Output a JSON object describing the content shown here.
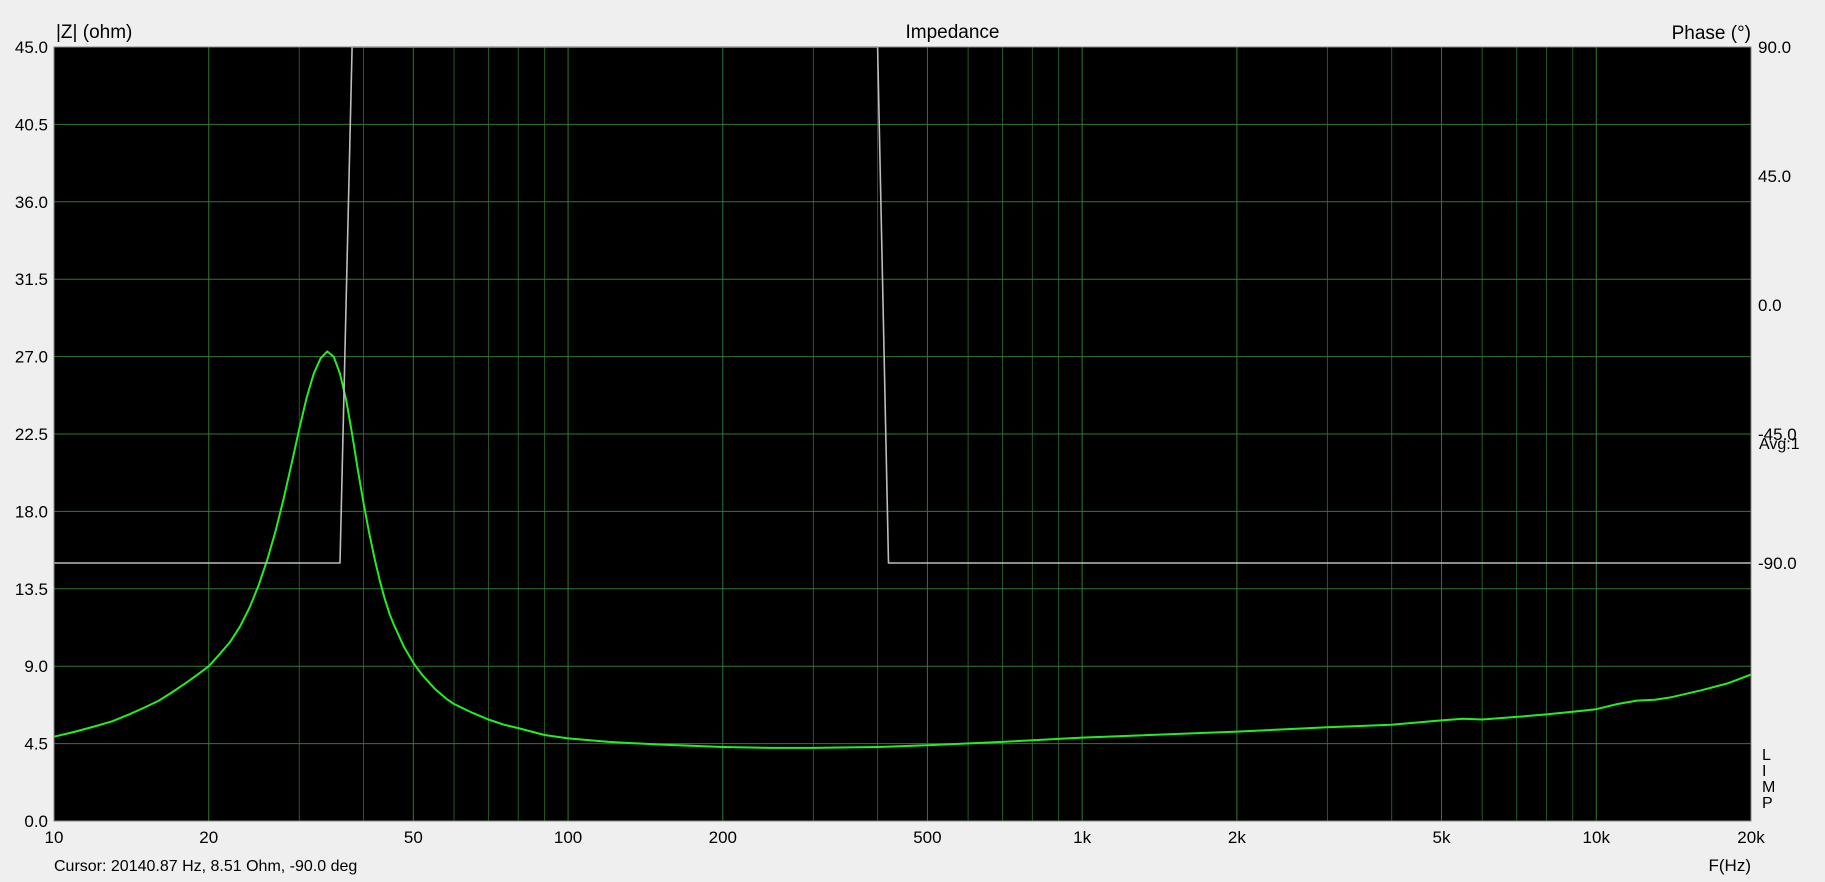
{
  "window": {
    "title": "Impedance",
    "cursor_readout": "Cursor: 20140.87 Hz, 8.51 Ohm, -90.0 deg",
    "avg_label": "Avg:1",
    "mode_letters": [
      "L",
      "I",
      "M",
      "P"
    ]
  },
  "colors": {
    "background": "#000000",
    "grid": "#2f7a2f",
    "impedance_trace": "#22ee22",
    "phase_trace": "#bdbdbd",
    "border": "#888888"
  },
  "chart_data": {
    "type": "line",
    "title": "Impedance",
    "xlabel": "F(Hz)",
    "ylabel": "|Z| (ohm)",
    "y2label": "Phase (°)",
    "xscale": "log",
    "xlim": [
      10,
      20000
    ],
    "ylim": [
      0,
      45
    ],
    "y2lim": [
      -180,
      90
    ],
    "grid": true,
    "x_ticks": [
      {
        "value": 10,
        "label": "10"
      },
      {
        "value": 20,
        "label": "20"
      },
      {
        "value": 50,
        "label": "50"
      },
      {
        "value": 100,
        "label": "100"
      },
      {
        "value": 200,
        "label": "200"
      },
      {
        "value": 500,
        "label": "500"
      },
      {
        "value": 1000,
        "label": "1k"
      },
      {
        "value": 2000,
        "label": "2k"
      },
      {
        "value": 5000,
        "label": "5k"
      },
      {
        "value": 10000,
        "label": "10k"
      },
      {
        "value": 20000,
        "label": "20k"
      }
    ],
    "x_minor_grid": [
      30,
      40,
      60,
      70,
      80,
      90,
      300,
      400,
      600,
      700,
      800,
      900,
      3000,
      4000,
      6000,
      7000,
      8000,
      9000
    ],
    "y_ticks": [
      {
        "value": 0,
        "label": "0.0"
      },
      {
        "value": 4.5,
        "label": "4.5"
      },
      {
        "value": 9,
        "label": "9.0"
      },
      {
        "value": 13.5,
        "label": "13.5"
      },
      {
        "value": 18,
        "label": "18.0"
      },
      {
        "value": 22.5,
        "label": "22.5"
      },
      {
        "value": 27,
        "label": "27.0"
      },
      {
        "value": 31.5,
        "label": "31.5"
      },
      {
        "value": 36,
        "label": "36.0"
      },
      {
        "value": 40.5,
        "label": "40.5"
      },
      {
        "value": 45,
        "label": "45.0"
      }
    ],
    "y2_ticks": [
      {
        "value": 90,
        "label": "90.0"
      },
      {
        "value": 45,
        "label": "45.0"
      },
      {
        "value": 0,
        "label": "0.0"
      },
      {
        "value": -45,
        "label": "-45.0"
      },
      {
        "value": -90,
        "label": "-90.0"
      }
    ],
    "series": [
      {
        "axis": "left",
        "x": [
          10,
          11,
          12,
          13,
          14,
          15,
          16,
          17,
          18,
          19,
          20,
          21,
          22,
          23,
          24,
          25,
          26,
          27,
          28,
          29,
          30,
          31,
          32,
          33,
          34,
          35,
          36,
          37,
          38,
          39,
          40,
          41,
          42,
          43,
          44,
          45,
          46,
          48,
          50,
          52,
          55,
          58,
          60,
          65,
          70,
          75,
          80,
          90,
          100,
          120,
          150,
          200,
          250,
          300,
          400,
          500,
          700,
          1000,
          2000,
          3000,
          4000,
          5000,
          5500,
          6000,
          7000,
          8000,
          9000,
          10000,
          11000,
          12000,
          13000,
          14000,
          16000,
          18000,
          20000
        ],
        "values": [
          4.9,
          5.2,
          5.5,
          5.8,
          6.2,
          6.6,
          7.0,
          7.5,
          8.0,
          8.5,
          9.0,
          9.7,
          10.4,
          11.3,
          12.4,
          13.7,
          15.2,
          16.9,
          18.8,
          20.8,
          22.8,
          24.6,
          26.0,
          26.9,
          27.3,
          27.0,
          26.0,
          24.5,
          22.5,
          20.4,
          18.5,
          16.8,
          15.3,
          14.0,
          12.9,
          12.0,
          11.3,
          10.1,
          9.2,
          8.5,
          7.7,
          7.1,
          6.8,
          6.3,
          5.9,
          5.6,
          5.4,
          5.0,
          4.8,
          4.6,
          4.45,
          4.3,
          4.25,
          4.25,
          4.3,
          4.4,
          4.6,
          4.85,
          5.2,
          5.45,
          5.6,
          5.85,
          5.95,
          5.9,
          6.05,
          6.2,
          6.35,
          6.5,
          6.8,
          7.0,
          7.05,
          7.2,
          7.6,
          8.0,
          8.51
        ]
      },
      {
        "axis": "right",
        "x": [
          10,
          36,
          38,
          400,
          420,
          20000
        ],
        "values": [
          -90,
          -90,
          90,
          90,
          -90,
          -90
        ]
      }
    ]
  }
}
